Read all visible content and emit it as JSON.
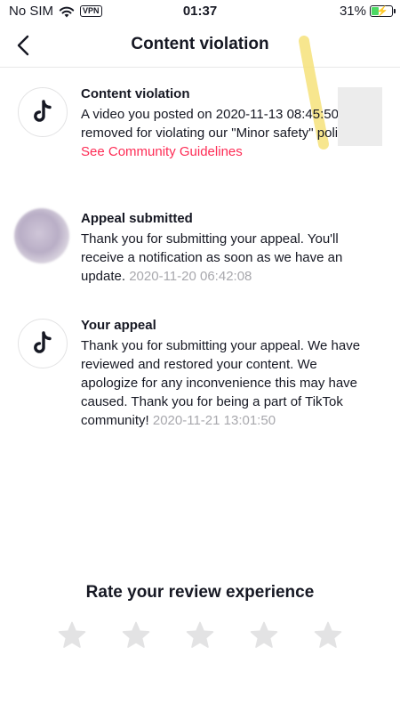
{
  "status_bar": {
    "carrier": "No SIM",
    "vpn": "VPN",
    "time": "01:37",
    "battery": "31%"
  },
  "nav": {
    "title": "Content violation"
  },
  "notifications": [
    {
      "title": "Content violation",
      "text": "A video you posted on 2020-11-13 08:45:50 was removed for violating our \"Minor safety\" policy ",
      "link": "See Community Guidelines",
      "icon": "tiktok-logo-icon"
    },
    {
      "title": "Appeal submitted",
      "text": "Thank you for submitting your appeal. You'll receive a notification as soon as we have an update. ",
      "timestamp": "2020-11-20 06:42:08"
    },
    {
      "title": "Your appeal",
      "text": "Thank you for submitting your appeal. We have reviewed and restored your content. We apologize for any inconvenience this may have caused. Thank you for being a part of TikTok community! ",
      "timestamp": "2020-11-21 13:01:50",
      "icon": "tiktok-logo-icon"
    }
  ],
  "rating": {
    "title": "Rate your review experience",
    "stars": 5
  },
  "colors": {
    "accent": "#fe2c55",
    "timestamp": "#a8a8ad",
    "star": "#e3e3e4"
  }
}
